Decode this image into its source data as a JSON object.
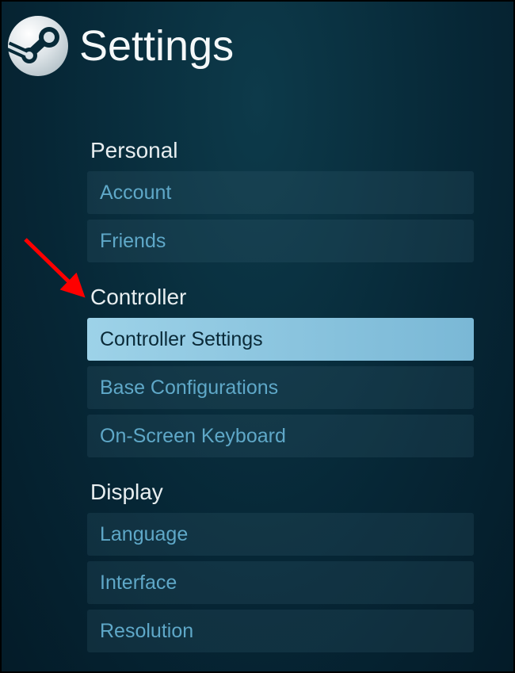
{
  "header": {
    "title": "Settings"
  },
  "sections": {
    "personal": {
      "heading": "Personal",
      "items": [
        {
          "label": "Account"
        },
        {
          "label": "Friends"
        }
      ]
    },
    "controller": {
      "heading": "Controller",
      "items": [
        {
          "label": "Controller Settings"
        },
        {
          "label": "Base Configurations"
        },
        {
          "label": "On-Screen Keyboard"
        }
      ]
    },
    "display": {
      "heading": "Display",
      "items": [
        {
          "label": "Language"
        },
        {
          "label": "Interface"
        },
        {
          "label": "Resolution"
        }
      ]
    }
  }
}
